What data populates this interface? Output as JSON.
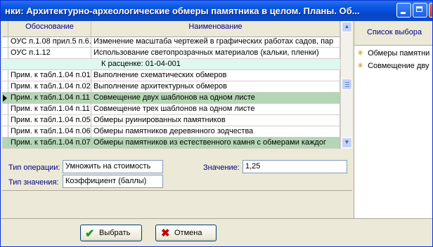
{
  "window": {
    "title": "нки: Архитектурно-археологические обмеры памятника в целом. Планы. Об..."
  },
  "grid": {
    "columns": [
      "Обоснование",
      "Наименование"
    ],
    "rows": [
      {
        "code": "ОУС п.1.08 прил.5 п.6.",
        "name": "Изменение масштаба чертежей в графических работах садов, пар",
        "style": "normal"
      },
      {
        "code": "ОУС п.1.12",
        "name": "Использование светопрозрачных материалов (кальки, пленки)",
        "style": "normal"
      },
      {
        "code": "",
        "name": "К расценке: 01-04-001",
        "style": "section"
      },
      {
        "code": "Прим. к табл.1.04 п.01",
        "name": "Выполнение схематических обмеров",
        "style": "normal"
      },
      {
        "code": "Прим. к табл.1.04 п.02",
        "name": "Выполнение архитектурных обмеров",
        "style": "normal"
      },
      {
        "code": "Прим. к табл.1.04 п.11",
        "name": "Совмещение двух шаблонов на одном листе",
        "style": "highlight"
      },
      {
        "code": "Прим. к табл.1.04 п.11",
        "name": "Совмещение трех шаблонов на одном листе",
        "style": "normal"
      },
      {
        "code": "Прим. к табл.1.04 п.05",
        "name": "Обмеры руинированных памятников",
        "style": "normal"
      },
      {
        "code": "Прим. к табл.1.04 п.06",
        "name": "Обмеры памятников деревянного зодчества",
        "style": "normal"
      },
      {
        "code": "Прим. к табл.1.04 п.07",
        "name": "Обмеры памятников из естественного камня с обмерами каждог",
        "style": "highlight"
      }
    ]
  },
  "side": {
    "title": "Список выбора",
    "items": [
      "Обмеры памятни",
      "Совмещение дву"
    ]
  },
  "form": {
    "op_type_label": "Тип операции:",
    "op_type_value": "Умножить на стоимость",
    "value_type_label": "Тип значения:",
    "value_type_value": "Коэффициент (баллы)",
    "value_label": "Значение:",
    "value_value": "1,25"
  },
  "buttons": {
    "select_label": "Выбрать",
    "cancel_label": "Отмена"
  },
  "colors": {
    "highlight_row": "#b4d6b4",
    "section_row": "#def7f0",
    "title_blue": "#0a58e6"
  }
}
